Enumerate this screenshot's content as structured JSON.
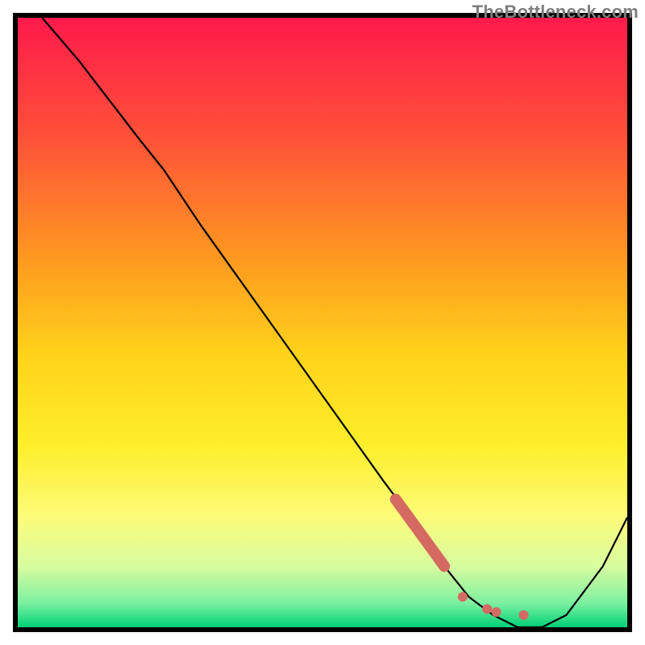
{
  "watermark": "TheBottleneck.com",
  "chart_data": {
    "type": "line",
    "title": "",
    "xlabel": "",
    "ylabel": "",
    "xlim": [
      0,
      100
    ],
    "ylim": [
      0,
      100
    ],
    "gradient_top_color": "#ff1a4b",
    "gradient_bottom_color": "#00d177",
    "gradient_stops": [
      {
        "offset": 0.0,
        "color": "#ff1a4b"
      },
      {
        "offset": 0.2,
        "color": "#ff5338"
      },
      {
        "offset": 0.4,
        "color": "#ff9a1f"
      },
      {
        "offset": 0.55,
        "color": "#ffd21a"
      },
      {
        "offset": 0.7,
        "color": "#ffee2a"
      },
      {
        "offset": 0.82,
        "color": "#fcfc7a"
      },
      {
        "offset": 0.9,
        "color": "#d8fca0"
      },
      {
        "offset": 0.96,
        "color": "#7df0a0"
      },
      {
        "offset": 1.0,
        "color": "#00d177"
      }
    ],
    "curve": {
      "x": [
        4,
        10,
        20,
        24,
        30,
        40,
        50,
        60,
        66,
        70,
        74,
        78,
        82,
        86,
        90,
        96,
        100
      ],
      "y": [
        100,
        93,
        80,
        75,
        66,
        52,
        38,
        24,
        16,
        10,
        5,
        2,
        0,
        0,
        2,
        10,
        18
      ]
    },
    "markers": {
      "thick_segment": {
        "x": [
          62,
          70
        ],
        "y": [
          21,
          10
        ],
        "color": "#d46a62",
        "width": 14
      },
      "dots": [
        {
          "x": 73,
          "y": 5,
          "r": 6,
          "color": "#d46a62"
        },
        {
          "x": 77,
          "y": 3,
          "r": 6,
          "color": "#d46a62"
        },
        {
          "x": 78.5,
          "y": 2.5,
          "r": 6,
          "color": "#d46a62"
        },
        {
          "x": 83,
          "y": 2,
          "r": 6,
          "color": "#d46a62"
        }
      ]
    },
    "frame_color": "#000000"
  }
}
